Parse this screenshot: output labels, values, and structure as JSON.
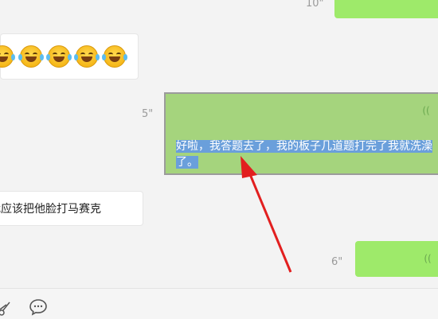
{
  "messages": {
    "top_duration": "10\"",
    "selected_duration": "5\"",
    "selected_text": "好啦，我答题去了，我的板子几道题打完了我就洗澡了。",
    "left_text": "我应该把他脸打马赛克",
    "bottom_duration": "6\"",
    "voice_icon": "(("
  },
  "icons": {
    "scissors": "scissors-icon",
    "comment": "comment-icon",
    "emoji": "crying-laughing-emoji",
    "voice": "voice-wave-icon",
    "annotation_arrow": "red-arrow"
  },
  "colors": {
    "green_bubble": "#9eea6a",
    "selected_bg": "#a5d47d",
    "selection_highlight": "#6a9fdb",
    "arrow": "#e21f1f"
  }
}
